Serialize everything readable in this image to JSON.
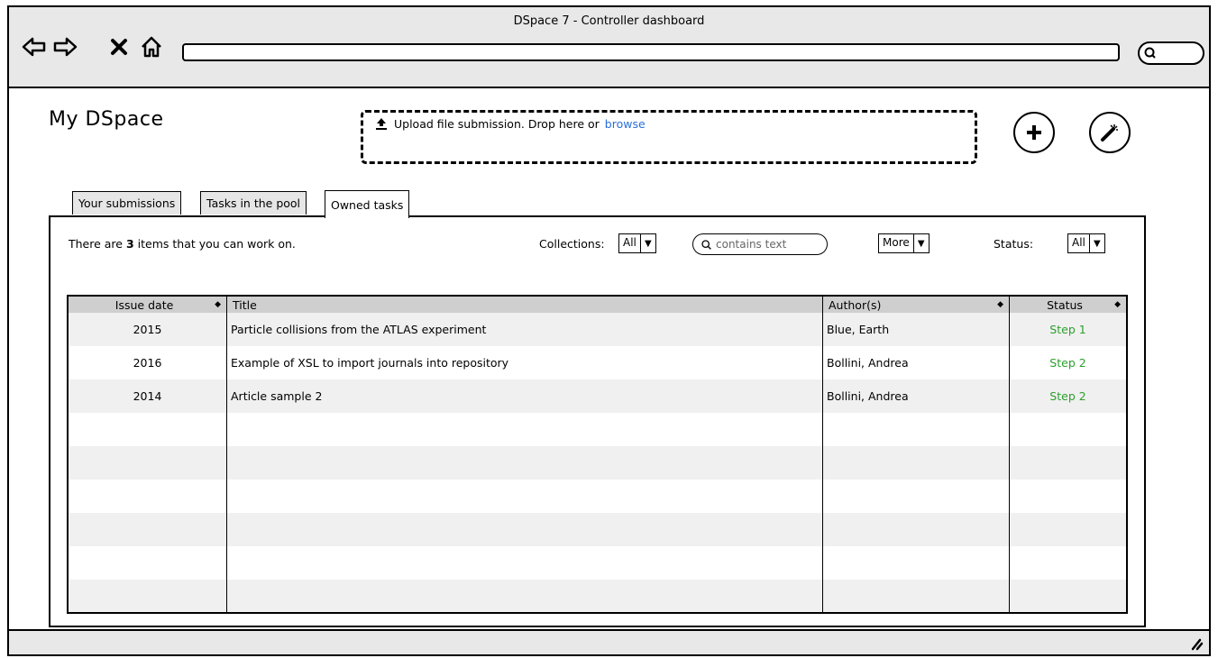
{
  "window": {
    "title": "DSpace 7 - Controller dashboard"
  },
  "page": {
    "title": "My DSpace"
  },
  "upload": {
    "text": "Upload file submission. Drop here or",
    "link": "browse"
  },
  "tabs": [
    {
      "label": "Your submissions"
    },
    {
      "label": "Tasks in the pool"
    },
    {
      "label": "Owned tasks"
    }
  ],
  "filters": {
    "info_prefix": "There are",
    "info_count": "3",
    "info_suffix": "items that you can work on.",
    "collections_label": "Collections:",
    "collections_value": "All",
    "search_placeholder": "contains text",
    "more_value": "More",
    "status_label": "Status:",
    "status_value": "All"
  },
  "table": {
    "headers": [
      "Issue date",
      "Title",
      "Author(s)",
      "Status"
    ],
    "rows": [
      {
        "date": "2015",
        "title": "Particle collisions from the ATLAS experiment",
        "author": "Blue, Earth",
        "status": "Step 1"
      },
      {
        "date": "2016",
        "title": "Example of XSL to import journals into repository",
        "author": "Bollini, Andrea",
        "status": "Step 2"
      },
      {
        "date": "2014",
        "title": "Article sample 2",
        "author": "Bollini, Andrea",
        "status": "Step 2"
      }
    ]
  },
  "colors": {
    "link": "#2a6fdb",
    "status": "#2e9e2e",
    "header_bg": "#cfcfcf",
    "stripe": "#f0f0f0",
    "chrome": "#e8e8e8"
  },
  "icons": [
    "back-arrow-icon",
    "forward-arrow-icon",
    "close-icon",
    "home-icon",
    "search-icon",
    "upload-icon",
    "plus-icon",
    "magic-wand-icon",
    "resize-grip-icon",
    "sort-icon",
    "dropdown-arrow-icon"
  ]
}
